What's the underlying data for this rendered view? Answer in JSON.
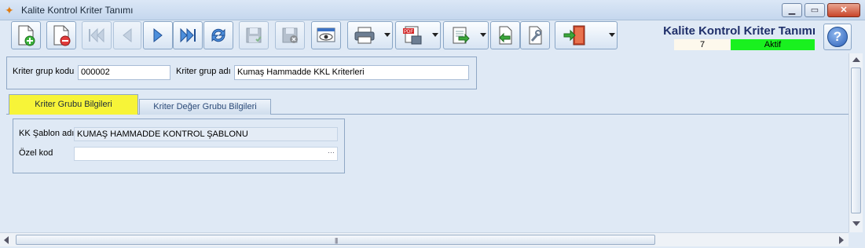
{
  "window": {
    "title": "Kalite Kontrol Kriter Tanımı",
    "minimize_label": "▁",
    "maximize_label": "▭",
    "close_label": "✕"
  },
  "toolbar": {
    "buttons": [
      {
        "name": "new-record-button",
        "icon": "new-document-icon"
      },
      {
        "name": "delete-record-button",
        "icon": "delete-document-icon"
      },
      {
        "name": "first-record-button",
        "icon": "first-icon"
      },
      {
        "name": "previous-record-button",
        "icon": "previous-icon"
      },
      {
        "name": "next-record-button",
        "icon": "next-icon"
      },
      {
        "name": "last-record-button",
        "icon": "last-icon"
      },
      {
        "name": "refresh-button",
        "icon": "refresh-icon"
      },
      {
        "name": "save-button",
        "icon": "save-icon"
      },
      {
        "name": "cancel-save-button",
        "icon": "cancel-save-icon"
      },
      {
        "name": "preview-button",
        "icon": "preview-icon"
      },
      {
        "name": "print-button",
        "icon": "printer-icon"
      },
      {
        "name": "pdf-export-button",
        "icon": "pdf-icon"
      },
      {
        "name": "export-button",
        "icon": "export-icon"
      },
      {
        "name": "import-button",
        "icon": "import-icon"
      },
      {
        "name": "settings-button",
        "icon": "tools-icon"
      },
      {
        "name": "exit-button",
        "icon": "exit-door-icon"
      }
    ]
  },
  "header": {
    "title": "Kalite Kontrol Kriter Tanımı",
    "record_count": "7",
    "status": "Aktif",
    "status_color": "#19f11f"
  },
  "form": {
    "group_code_label": "Kriter grup kodu",
    "group_code_value": "000002",
    "group_name_label": "Kriter grup adı",
    "group_name_value": "Kumaş Hammadde KKL Kriterleri"
  },
  "tabs": [
    {
      "label": "Kriter Grubu Bilgileri",
      "active": true
    },
    {
      "label": "Kriter Değer Grubu Bilgileri",
      "active": false
    }
  ],
  "tab_page": {
    "template_label": "KK Şablon adı",
    "template_value": "KUMAŞ HAMMADDE KONTROL ŞABLONU",
    "special_code_label": "Özel kod",
    "special_code_value": "",
    "lookup_dots": "···"
  },
  "colors": {
    "active_tab": "#f7f438",
    "header_title": "#1f2f6a"
  }
}
